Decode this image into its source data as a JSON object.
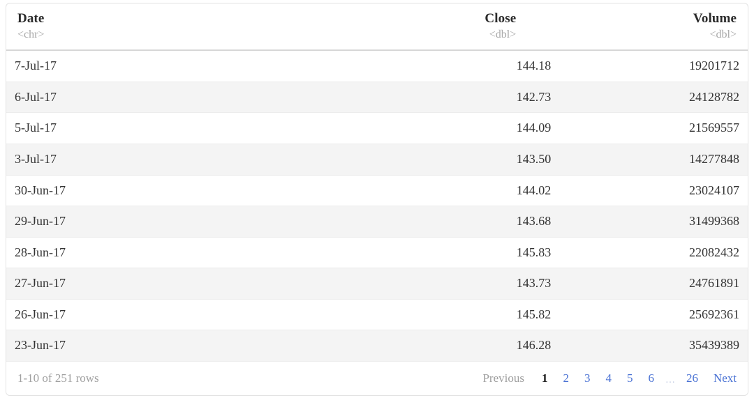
{
  "table": {
    "columns": [
      {
        "label": "Date",
        "type_hint": "<chr>",
        "align": "left"
      },
      {
        "label": "Close",
        "type_hint": "<dbl>",
        "align": "right"
      },
      {
        "label": "Volume",
        "type_hint": "<dbl>",
        "align": "right"
      }
    ],
    "rows": [
      {
        "date": "7-Jul-17",
        "close": "144.18",
        "volume": "19201712"
      },
      {
        "date": "6-Jul-17",
        "close": "142.73",
        "volume": "24128782"
      },
      {
        "date": "5-Jul-17",
        "close": "144.09",
        "volume": "21569557"
      },
      {
        "date": "3-Jul-17",
        "close": "143.50",
        "volume": "14277848"
      },
      {
        "date": "30-Jun-17",
        "close": "144.02",
        "volume": "23024107"
      },
      {
        "date": "29-Jun-17",
        "close": "143.68",
        "volume": "31499368"
      },
      {
        "date": "28-Jun-17",
        "close": "145.83",
        "volume": "22082432"
      },
      {
        "date": "27-Jun-17",
        "close": "143.73",
        "volume": "24761891"
      },
      {
        "date": "26-Jun-17",
        "close": "145.82",
        "volume": "25692361"
      },
      {
        "date": "23-Jun-17",
        "close": "146.28",
        "volume": "35439389"
      }
    ]
  },
  "footer": {
    "row_info": "1-10 of 251 rows",
    "previous_label": "Previous",
    "next_label": "Next",
    "ellipsis": "…",
    "pages": [
      {
        "label": "1",
        "current": true
      },
      {
        "label": "2",
        "current": false
      },
      {
        "label": "3",
        "current": false
      },
      {
        "label": "4",
        "current": false
      },
      {
        "label": "5",
        "current": false
      },
      {
        "label": "6",
        "current": false
      }
    ],
    "last_page": "26"
  },
  "colors": {
    "link": "#4a72d4",
    "muted": "#a0a0a0",
    "text": "#333333",
    "stripe": "#f4f4f4",
    "border": "#e3e3e3"
  }
}
